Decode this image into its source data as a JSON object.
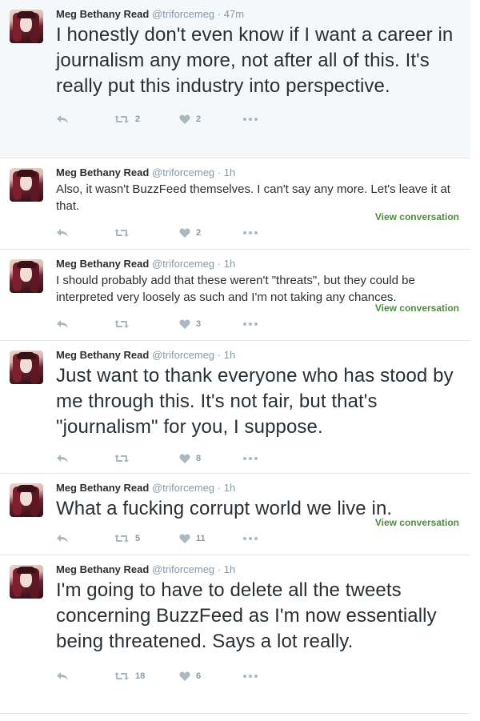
{
  "author": {
    "name": "Meg Bethany Read",
    "handle": "@triforcemeg",
    "dot": "·"
  },
  "tweets": [
    {
      "time": "47m",
      "text": "I honestly don't even know if I want a career in journalism any more, not after all of this. It's really put this industry into perspective.",
      "retweets": "2",
      "likes": "2",
      "view_conversation": ""
    },
    {
      "time": "1h",
      "text": "Also, it wasn't BuzzFeed themselves. I can't say any more. Let's leave it at that.",
      "retweets": "",
      "likes": "2",
      "view_conversation": "View conversation"
    },
    {
      "time": "1h",
      "text": "I should probably add that these weren't \"threats\", but they could be interpreted very loosely as such and I'm not taking any chances.",
      "retweets": "",
      "likes": "3",
      "view_conversation": "View conversation"
    },
    {
      "time": "1h",
      "text": "Just want to thank everyone who has stood by me through this. It's not fair, but that's \"journalism\" for you, I suppose.",
      "retweets": "",
      "likes": "8",
      "view_conversation": ""
    },
    {
      "time": "1h",
      "text": "What a fucking corrupt world we live in.",
      "retweets": "5",
      "likes": "11",
      "view_conversation": "View conversation"
    },
    {
      "time": "1h",
      "text": "I'm going to have to delete all the tweets concerning BuzzFeed as I'm now essentially being threatened. Says a lot really.",
      "retweets": "18",
      "likes": "6",
      "view_conversation": ""
    }
  ],
  "icons": {
    "reply": "reply-arrow-icon",
    "retweet": "retweet-icon",
    "like": "heart-icon",
    "more": "more-dots-icon"
  },
  "colors": {
    "highlight_bg": "#f5f8fa",
    "icon": "#aab8c2",
    "link": "#4f8a3e",
    "meta": "#8899a6"
  }
}
